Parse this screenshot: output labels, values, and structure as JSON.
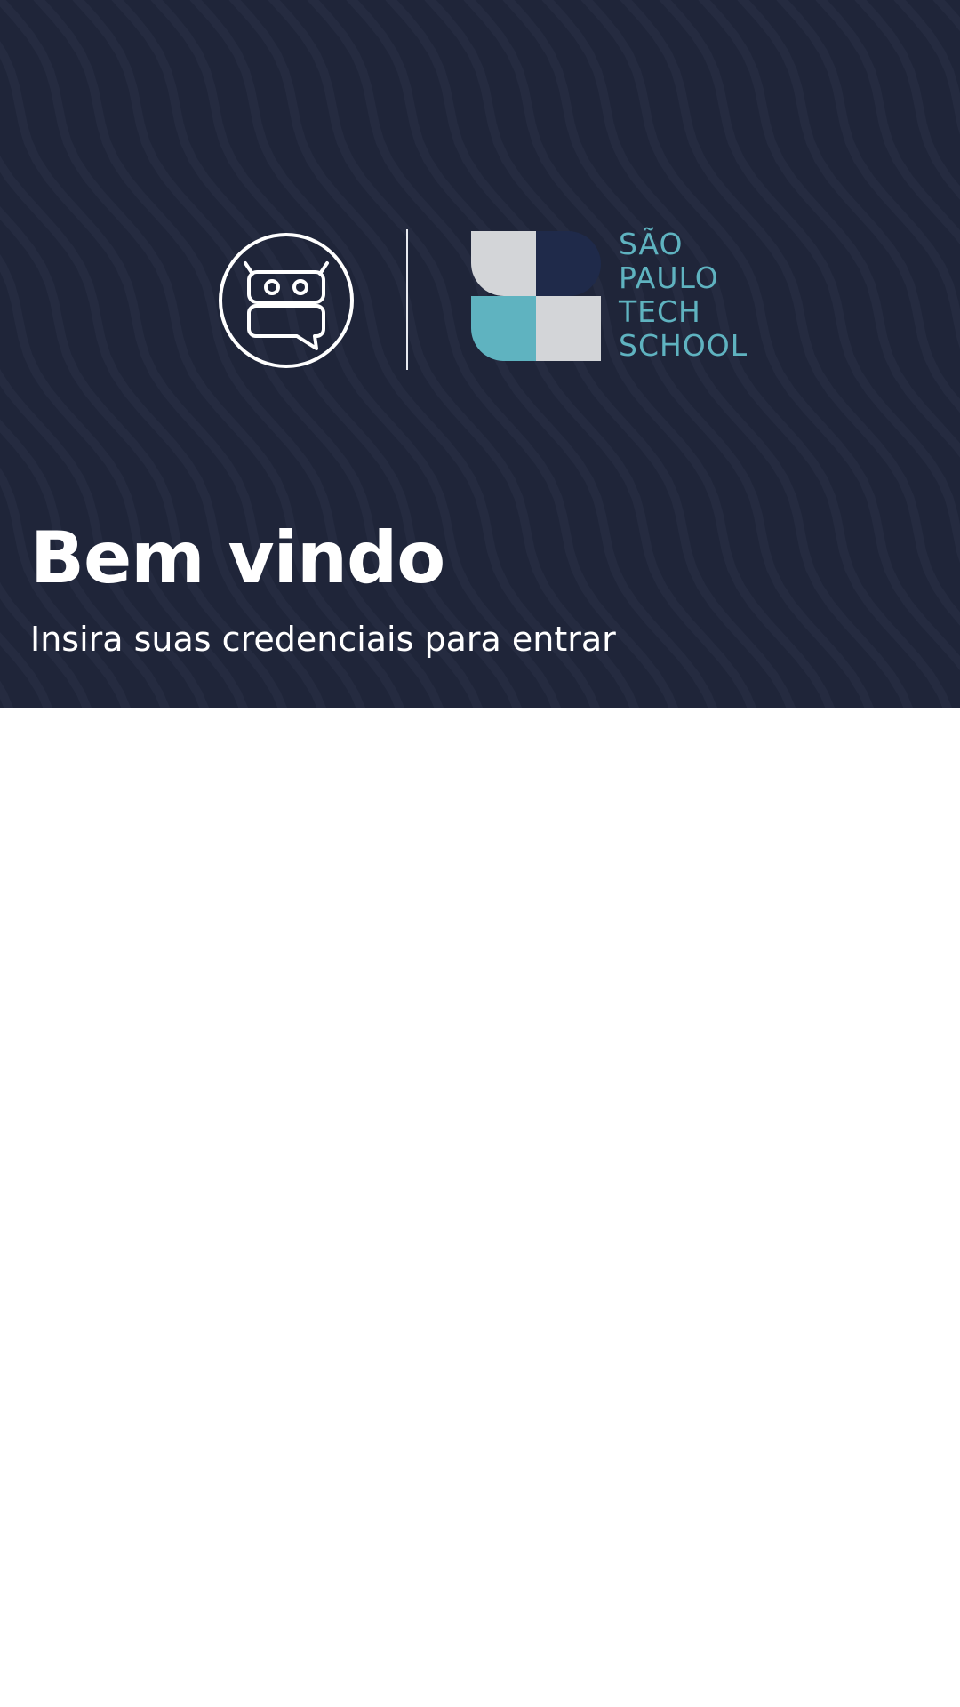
{
  "hero": {
    "background_color": "#1f2539",
    "title": "Bem vindo",
    "subtitle": "Insira suas credenciais para entrar"
  },
  "logos": {
    "app_logo_icon": "robot-chat-icon",
    "partner_logo_icon": "sao-paulo-tech-school-mark",
    "partner_name_lines": [
      "SÃO",
      "PAULO",
      "TECH",
      "SCHOOL"
    ],
    "partner_colors": {
      "teal": "#5fb3c0",
      "navy": "#1f2a4a",
      "light_gray": "#d3d5d8"
    }
  }
}
